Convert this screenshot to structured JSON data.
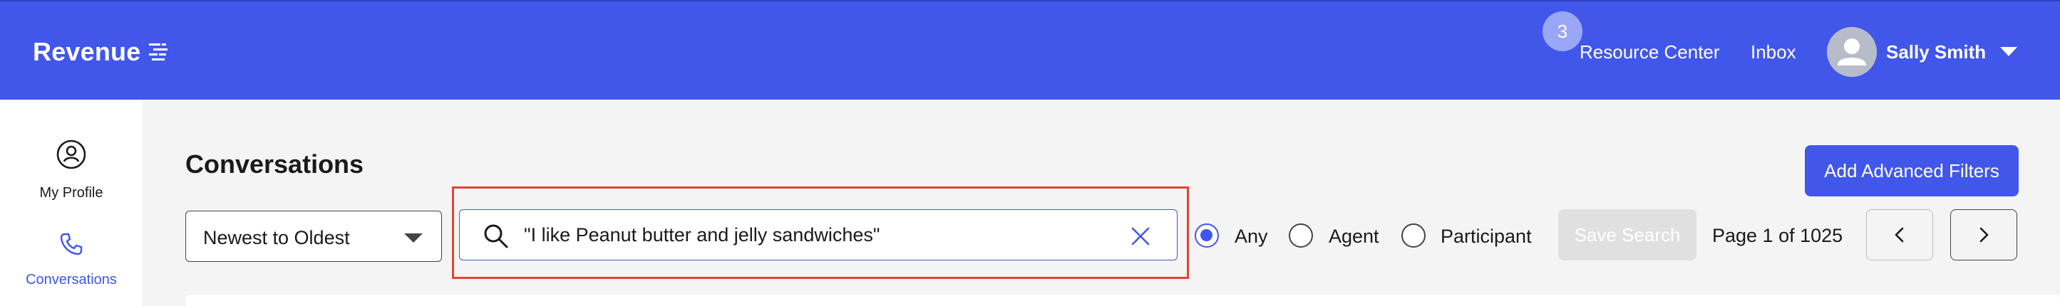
{
  "header": {
    "logo_text": "Revenue",
    "notification_count": "3",
    "nav": {
      "resource_center": "Resource Center",
      "inbox": "Inbox"
    },
    "user": {
      "name": "Sally Smith"
    },
    "colors": {
      "brand": "#4157ea"
    }
  },
  "sidebar": {
    "items": [
      {
        "label": "My Profile",
        "icon": "user-circle-icon",
        "active": false
      },
      {
        "label": "Conversations",
        "icon": "phone-icon",
        "active": true
      }
    ]
  },
  "main": {
    "title": "Conversations",
    "advanced_filters_label": "Add Advanced Filters",
    "sort": {
      "selected": "Newest to Oldest"
    },
    "search": {
      "value": "\"I like Peanut butter and jelly sandwiches\""
    },
    "speaker_filter": {
      "options": [
        {
          "label": "Any",
          "checked": true
        },
        {
          "label": "Agent",
          "checked": false
        },
        {
          "label": "Participant",
          "checked": false
        }
      ]
    },
    "save_search_label": "Save Search",
    "pagination": {
      "label": "Page 1 of 1025"
    }
  }
}
